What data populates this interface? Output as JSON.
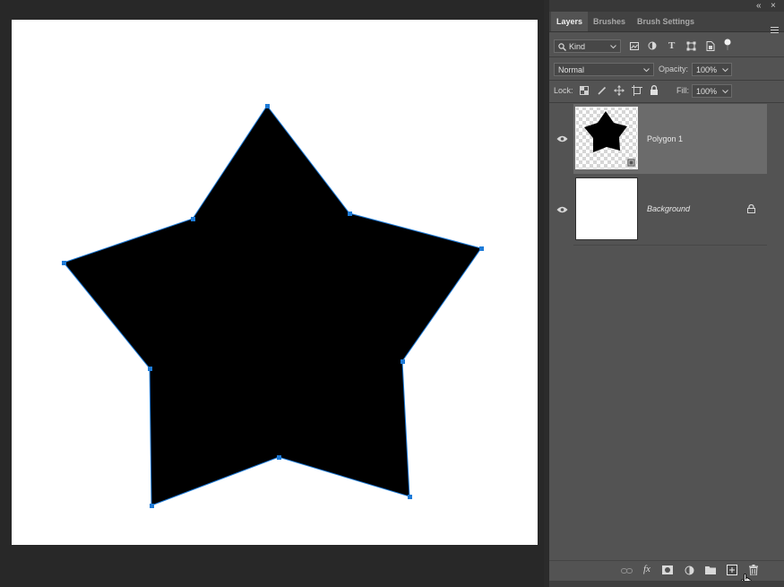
{
  "panel": {
    "collapse_label": "«",
    "close_label": "×",
    "tabs": [
      {
        "label": "Layers",
        "active": true
      },
      {
        "label": "Brushes",
        "active": false
      },
      {
        "label": "Brush Settings",
        "active": false
      }
    ],
    "filter": {
      "value": "Kind",
      "icons": [
        "pixel-layer-filter-icon",
        "adjustment-layer-filter-icon",
        "type-layer-filter-icon",
        "shape-layer-filter-icon",
        "smart-object-filter-icon",
        "filter-toggle-icon"
      ],
      "type_glyph": "T"
    },
    "blend_mode": "Normal",
    "opacity_label": "Opacity:",
    "opacity_value": "100%",
    "lock_label": "Lock:",
    "fill_label": "Fill:",
    "fill_value": "100%",
    "layers": [
      {
        "name": "Polygon 1",
        "selected": true,
        "visible": true
      },
      {
        "name": "Background",
        "selected": false,
        "visible": true,
        "locked": true
      }
    ],
    "footer_icons": [
      "link-layers-icon",
      "fx-icon",
      "add-mask-icon",
      "new-adjustment-icon",
      "new-group-icon",
      "new-layer-icon",
      "delete-layer-icon"
    ],
    "fx_label": "fx"
  },
  "colors": {
    "panel_bg": "#535353",
    "workspace_bg": "#282828",
    "selected_layer": "#6b6b6b",
    "path_anchor": "#1e7bd8"
  }
}
